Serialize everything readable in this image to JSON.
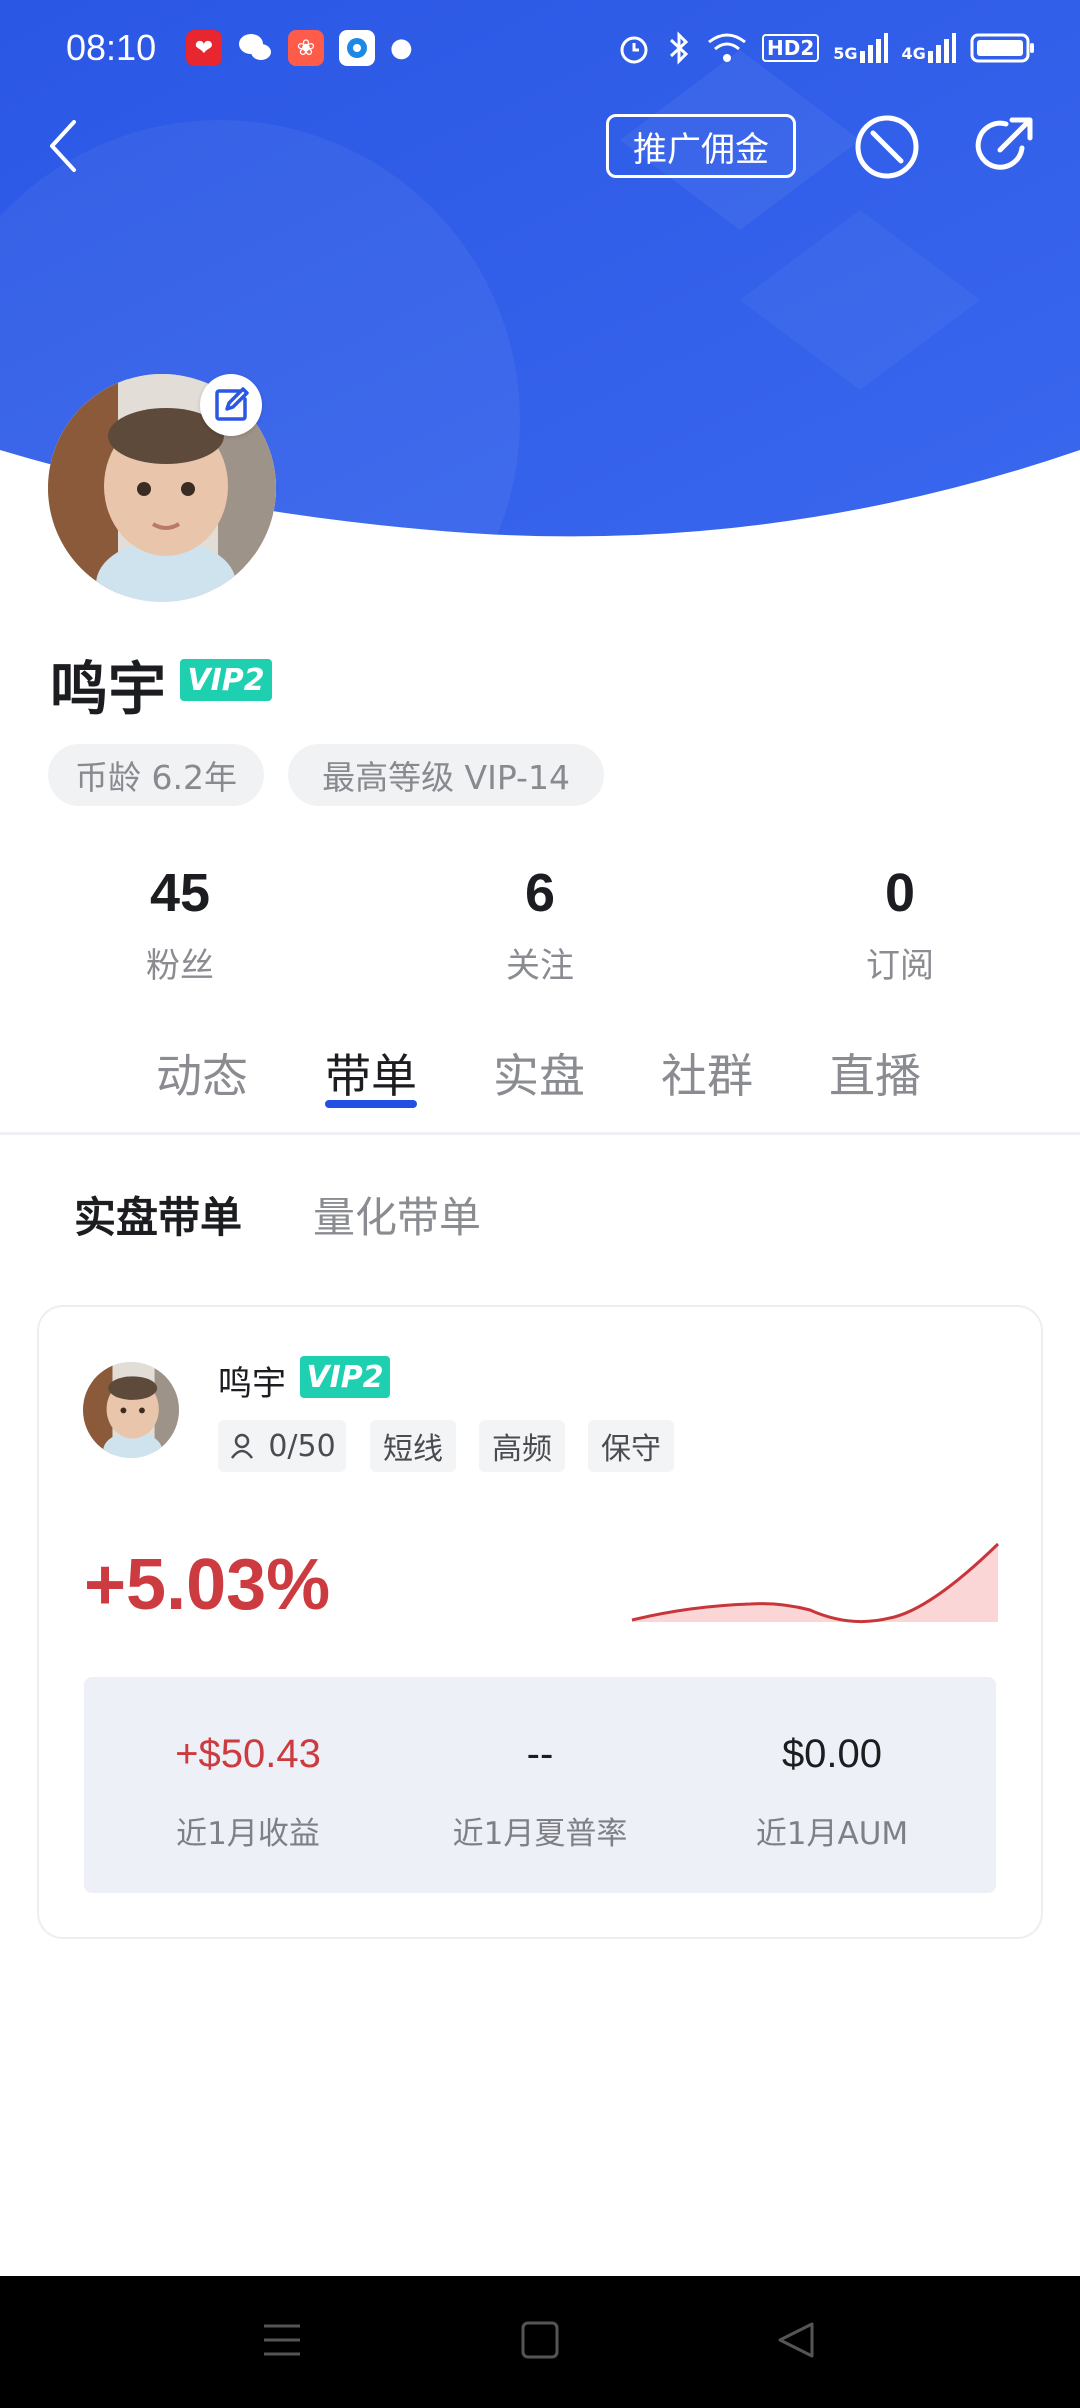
{
  "status_bar": {
    "time": "08:10",
    "signal_labels": [
      "5G",
      "4G"
    ],
    "hd_label": "HD2"
  },
  "header": {
    "promo_button": "推广佣金"
  },
  "profile": {
    "name": "鸣宇",
    "vip": "VIP2",
    "chips": [
      "币龄 6.2年",
      "最高等级 VIP-14"
    ],
    "stats": [
      {
        "value": "45",
        "label": "粉丝"
      },
      {
        "value": "6",
        "label": "关注"
      },
      {
        "value": "0",
        "label": "订阅"
      }
    ]
  },
  "tabs": [
    "动态",
    "带单",
    "实盘",
    "社群",
    "直播"
  ],
  "active_tab": "带单",
  "subtabs": [
    "实盘带单",
    "量化带单"
  ],
  "card": {
    "name": "鸣宇",
    "vip": "VIP2",
    "followers": "0/50",
    "tags": [
      "短线",
      "高频",
      "保守"
    ],
    "return": "+5.03%",
    "metrics": [
      {
        "value": "+$50.43",
        "label": "近1月收益"
      },
      {
        "value": "--",
        "label": "近1月夏普率"
      },
      {
        "value": "$0.00",
        "label": "近1月AUM"
      }
    ]
  },
  "colors": {
    "header_blue": "#2e5be6",
    "accent_blue": "#2150e3",
    "vip_green": "#1ecfb0",
    "profit_red": "#cc3b3f"
  }
}
